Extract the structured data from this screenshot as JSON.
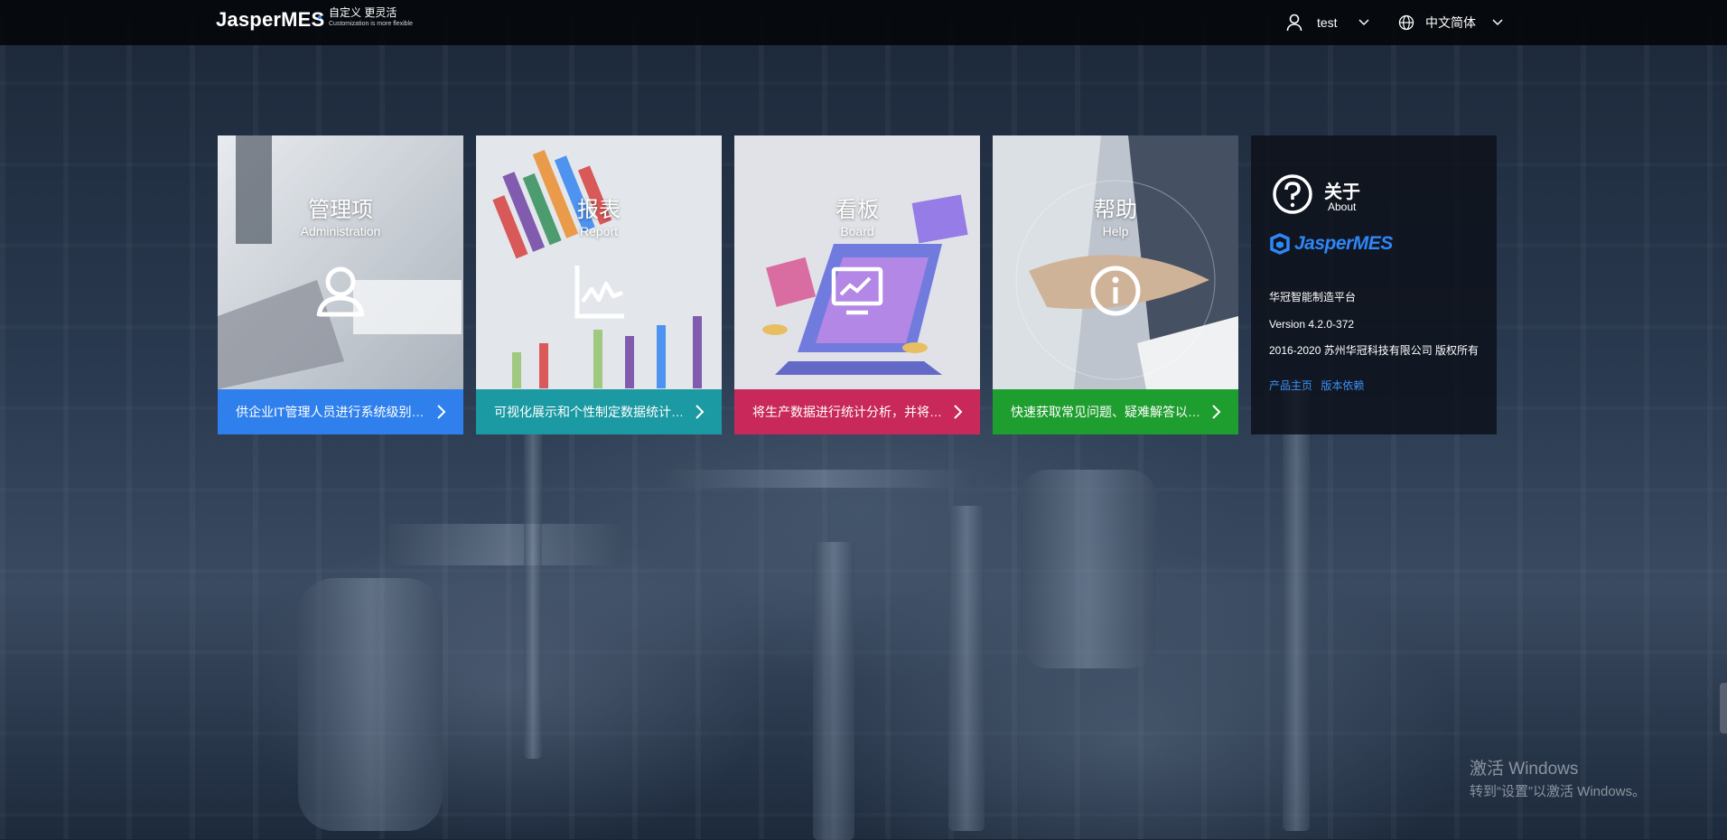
{
  "header": {
    "logo": "JasperMES",
    "tagline": "自定义 更灵活",
    "tagline_sub": "Customization is more flexible",
    "user": "test",
    "language": "中文简体"
  },
  "cards": [
    {
      "title": "管理项",
      "subtitle": "Administration",
      "description": "供企业IT管理人员进行系统级别管理",
      "icon": "user-icon",
      "color": "#2f80ed"
    },
    {
      "title": "报表",
      "subtitle": "Report",
      "description": "可视化展示和个性制定数据统计…",
      "icon": "chart-line-icon",
      "color": "#1b9aa3"
    },
    {
      "title": "看板",
      "subtitle": "Board",
      "description": "将生产数据进行统计分析，并将…",
      "icon": "monitor-chart-icon",
      "color": "#c8295a"
    },
    {
      "title": "帮助",
      "subtitle": "Help",
      "description": "快速获取常见问题、疑难解答以…",
      "icon": "info-icon",
      "color": "#1e9e2e"
    }
  ],
  "about": {
    "title": "关于",
    "subtitle": "About",
    "brand": "JasperMES",
    "platform": "华冠智能制造平台",
    "version": "Version 4.2.0-372",
    "copyright": "2016-2020 苏州华冠科技有限公司 版权所有",
    "link_home": "产品主页",
    "link_deps": "版本依赖"
  },
  "windows_notice": {
    "title": "激活 Windows",
    "message": "转到“设置”以激活 Windows。"
  }
}
